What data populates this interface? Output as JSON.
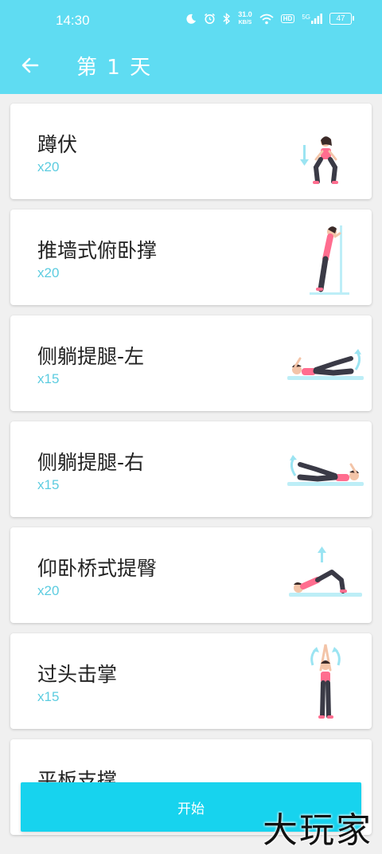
{
  "statusbar": {
    "time": "14:30",
    "net_speed_value": "31.0",
    "net_speed_unit": "KB/S",
    "hd_label": "HD",
    "signal_label": "5G",
    "battery": "47"
  },
  "header": {
    "title": "第 1 天"
  },
  "colors": {
    "header_bg": "#5fdcf2",
    "accent": "#17d3ee",
    "reps_text": "#5ccce0"
  },
  "exercises": [
    {
      "name": "蹲伏",
      "reps": "x20",
      "icon": "squat-illustration-icon"
    },
    {
      "name": "推墙式俯卧撑",
      "reps": "x20",
      "icon": "wall-pushup-illustration-icon"
    },
    {
      "name": "侧躺提腿-左",
      "reps": "x15",
      "icon": "side-leg-lift-left-illustration-icon"
    },
    {
      "name": "侧躺提腿-右",
      "reps": "x15",
      "icon": "side-leg-lift-right-illustration-icon"
    },
    {
      "name": "仰卧桥式提臀",
      "reps": "x20",
      "icon": "glute-bridge-illustration-icon"
    },
    {
      "name": "过头击掌",
      "reps": "x15",
      "icon": "overhead-clap-illustration-icon"
    },
    {
      "name": "平板支撑",
      "reps": "",
      "icon": "plank-illustration-icon"
    }
  ],
  "start_button": {
    "label": "开始"
  },
  "watermark": "大玩家"
}
